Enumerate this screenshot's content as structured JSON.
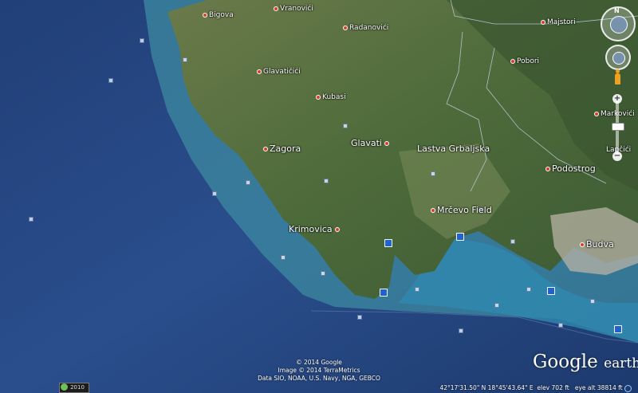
{
  "places": [
    {
      "id": "bigova",
      "label": "Bigova",
      "dot": true
    },
    {
      "id": "vranovici",
      "label": "Vranovići",
      "dot": true
    },
    {
      "id": "radanovici",
      "label": "Radanovići",
      "dot": true
    },
    {
      "id": "majstori",
      "label": "Majstori",
      "dot": true
    },
    {
      "id": "glavatcici",
      "label": "Glavatičići",
      "dot": true
    },
    {
      "id": "pobori",
      "label": "Pobori",
      "dot": true
    },
    {
      "id": "kubasi",
      "label": "Kubasi",
      "dot": true
    },
    {
      "id": "markovici",
      "label": "Markovići",
      "dot": true
    },
    {
      "id": "zagora",
      "label": "Zagora",
      "dot": true,
      "big": true
    },
    {
      "id": "glavati",
      "label": "Glavati",
      "dot": true,
      "big": true
    },
    {
      "id": "lastva",
      "label": "Lastva Grbaljska",
      "dot": false,
      "big": true
    },
    {
      "id": "lapcici",
      "label": "Lapčići",
      "dot": false
    },
    {
      "id": "podostrog",
      "label": "Podostrog",
      "dot": true,
      "big": true
    },
    {
      "id": "mrcevo",
      "label": "Mrčevo Field",
      "dot": true,
      "big": true
    },
    {
      "id": "krimovica",
      "label": "Krimovica",
      "dot": true,
      "big": true
    },
    {
      "id": "budva",
      "label": "Budva",
      "dot": true,
      "big": true
    }
  ],
  "attribution": {
    "line1": "© 2014 Google",
    "line2": "Image © 2014 TerraMetrics",
    "line3": "Data SIO, NOAA, U.S. Navy, NGA, GEBCO"
  },
  "historical_year": "2010",
  "status": {
    "coords": "42°17'31.50\" N   18°45'43.64\" E",
    "elev_label": "elev",
    "elev": "702 ft",
    "eye_alt_label": "eye alt",
    "eye_alt": "38814 ft"
  },
  "logo": {
    "google": "Google",
    "earth": "earth"
  },
  "controls": {
    "north": "N",
    "zoom_in": "+",
    "zoom_out": "−"
  }
}
